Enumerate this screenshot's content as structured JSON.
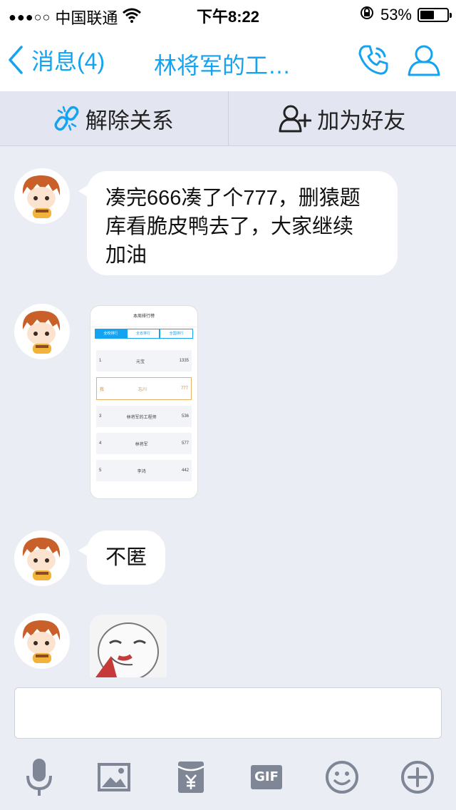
{
  "status_bar": {
    "signal": "●●●○○",
    "carrier": "中国联通",
    "time": "下午8:22",
    "battery_percent": "53%",
    "battery_level": 0.53
  },
  "nav": {
    "back_label": "消息(4)",
    "title": "林将军的工…",
    "accent_color": "#14a3f0"
  },
  "actions": {
    "unlink_label": "解除关系",
    "add_friend_label": "加为好友"
  },
  "messages": [
    {
      "type": "text",
      "text_lines": [
        "凑完666凑了个777，删猿题",
        "库看脆皮鸭去了，大家继续",
        "加油"
      ]
    },
    {
      "type": "image",
      "screenshot": {
        "title": "本周排行榜",
        "tabs": [
          "全校排行",
          "全省排行",
          "全国排行"
        ],
        "rows": [
          {
            "rank": "1",
            "name": "元宝",
            "score": "1335"
          },
          {
            "rank": "我",
            "name": "忘川",
            "score": "777"
          },
          {
            "rank": "3",
            "name": "林将军的工程师",
            "score": "536"
          },
          {
            "rank": "4",
            "name": "林将军",
            "score": "577"
          },
          {
            "rank": "5",
            "name": "李鸿",
            "score": "442"
          }
        ]
      }
    },
    {
      "type": "text",
      "text": "不匿"
    },
    {
      "type": "sticker"
    }
  ],
  "toolbar": {
    "gif_label": "GIF",
    "icons": [
      "microphone-icon",
      "image-icon",
      "red-packet-icon",
      "gif-icon",
      "emoji-icon",
      "plus-icon"
    ],
    "icon_color": "#7f8796"
  }
}
